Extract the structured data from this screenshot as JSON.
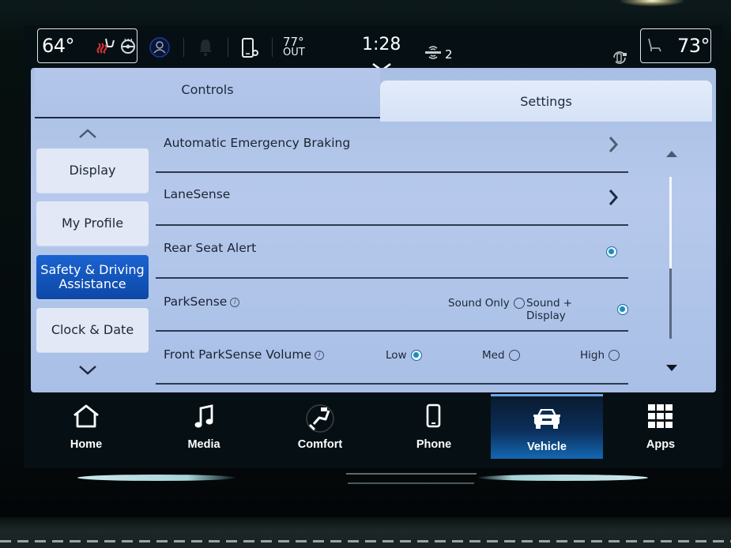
{
  "status_bar": {
    "driver_temp": "64°",
    "passenger_temp": "73°",
    "outside_temp": "77°",
    "outside_label": "OUT",
    "time": "1:28",
    "connected_devices": "2",
    "icons": [
      "heated-seat-icon",
      "heated-steering-wheel-icon",
      "profile-icon",
      "notification-bell-icon",
      "phone-settings-icon",
      "wireless-signal-icon",
      "auto-climate-icon",
      "passenger-seat-icon"
    ],
    "colors": {
      "heated_seat": "#e0333a",
      "profile_ring": "#1f3a9e"
    }
  },
  "tabs": [
    {
      "label": "Controls",
      "active": false
    },
    {
      "label": "Settings",
      "active": true
    }
  ],
  "sidebar": {
    "items": [
      {
        "label": "Display",
        "active": false
      },
      {
        "label": "My Profile",
        "active": false
      },
      {
        "label": "Safety & Driving Assistance",
        "active": true
      },
      {
        "label": "Clock & Date",
        "active": false
      }
    ]
  },
  "settings": {
    "rows": [
      {
        "label": "Automatic Emergency Braking",
        "control": "chevron"
      },
      {
        "label": "LaneSense",
        "control": "chevron"
      },
      {
        "label": "Rear Seat Alert",
        "control": "radio",
        "selected": true
      },
      {
        "label": "ParkSense",
        "info": true,
        "options": [
          {
            "label": "Sound Only",
            "selected": false
          },
          {
            "label": "Sound + Display",
            "selected": true
          }
        ]
      },
      {
        "label": "Front ParkSense Volume",
        "info": true,
        "options": [
          {
            "label": "Low",
            "selected": true
          },
          {
            "label": "Med",
            "selected": false
          },
          {
            "label": "High",
            "selected": false
          }
        ]
      }
    ],
    "scroll_position": 0.0
  },
  "bottom_nav": {
    "items": [
      {
        "label": "Home",
        "icon": "home-icon",
        "active": false
      },
      {
        "label": "Media",
        "icon": "music-note-icon",
        "active": false
      },
      {
        "label": "Comfort",
        "icon": "reclined-seat-icon",
        "active": false
      },
      {
        "label": "Phone",
        "icon": "phone-icon",
        "active": false
      },
      {
        "label": "Vehicle",
        "icon": "car-icon",
        "active": true
      },
      {
        "label": "Apps",
        "icon": "apps-grid-icon",
        "active": false
      }
    ]
  },
  "colors": {
    "accent": "#0d48a6",
    "panel_bg": "#b6c9ec",
    "radio_on": "#1a8dbf",
    "nav_active": "#1467b3"
  }
}
